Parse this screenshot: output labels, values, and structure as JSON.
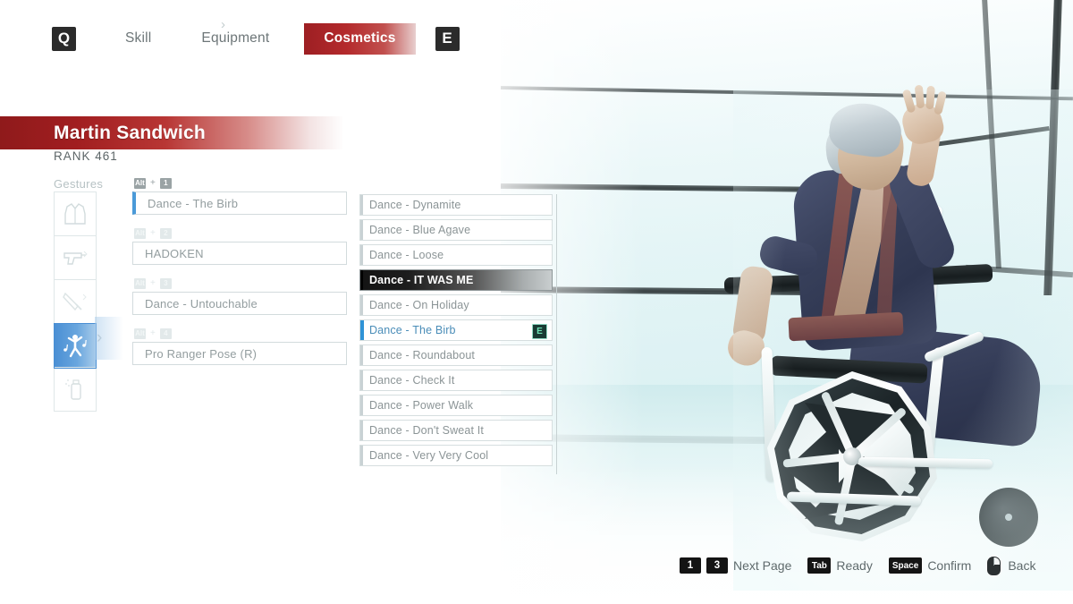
{
  "top_nav": {
    "left_key": "Q",
    "right_key": "E",
    "tabs": [
      {
        "label": "Skill",
        "active": false
      },
      {
        "label": "Equipment",
        "active": false
      },
      {
        "label": "Cosmetics",
        "active": true
      }
    ]
  },
  "player": {
    "name": "Martin Sandwich",
    "rank": "RANK 461"
  },
  "categories": {
    "label": "Gestures",
    "items": [
      {
        "name": "clothing",
        "icon": "jacket-icon",
        "active": false
      },
      {
        "name": "pistol",
        "icon": "pistol-icon",
        "active": false
      },
      {
        "name": "melee",
        "icon": "melee-weapon-icon",
        "active": false
      },
      {
        "name": "gestures",
        "icon": "dancing-figure-icon",
        "active": true
      },
      {
        "name": "spray",
        "icon": "spray-can-icon",
        "active": false
      }
    ]
  },
  "equipped_slots": [
    {
      "modifier": "Alt",
      "key": "1",
      "value": "Dance - The Birb",
      "selected": true
    },
    {
      "modifier": "Alt",
      "key": "2",
      "value": "HADOKEN",
      "selected": false
    },
    {
      "modifier": "Alt",
      "key": "3",
      "value": "Dance - Untouchable",
      "selected": false
    },
    {
      "modifier": "Alt",
      "key": "4",
      "value": "Pro Ranger Pose (R)",
      "selected": false
    }
  ],
  "item_list": [
    {
      "label": "Dance - Dynamite",
      "state": "normal",
      "badge": ""
    },
    {
      "label": "Dance - Blue Agave",
      "state": "normal",
      "badge": ""
    },
    {
      "label": "Dance - Loose",
      "state": "normal",
      "badge": ""
    },
    {
      "label": "Dance - IT WAS ME",
      "state": "highlight",
      "badge": ""
    },
    {
      "label": "Dance - On Holiday",
      "state": "normal",
      "badge": ""
    },
    {
      "label": "Dance - The Birb",
      "state": "equipped",
      "badge": "E"
    },
    {
      "label": "Dance - Roundabout",
      "state": "normal",
      "badge": ""
    },
    {
      "label": "Dance - Check It",
      "state": "normal",
      "badge": ""
    },
    {
      "label": "Dance - Power Walk",
      "state": "normal",
      "badge": ""
    },
    {
      "label": "Dance - Don't Sweat It",
      "state": "normal",
      "badge": ""
    },
    {
      "label": "Dance - Very Very Cool",
      "state": "normal",
      "badge": ""
    }
  ],
  "hints": [
    {
      "keys": [
        "1",
        "3"
      ],
      "label": "Next Page",
      "icon": ""
    },
    {
      "keys": [
        "Tab"
      ],
      "label": "Ready",
      "icon": ""
    },
    {
      "keys": [
        "Space"
      ],
      "label": "Confirm",
      "icon": ""
    },
    {
      "keys": [],
      "label": "Back",
      "icon": "mouse-right-click-icon"
    }
  ],
  "colors": {
    "accent_red": "#a11e20",
    "accent_blue": "#4a9ad8",
    "badge_green": "#6fe3b6",
    "text_muted": "#8b9496"
  }
}
